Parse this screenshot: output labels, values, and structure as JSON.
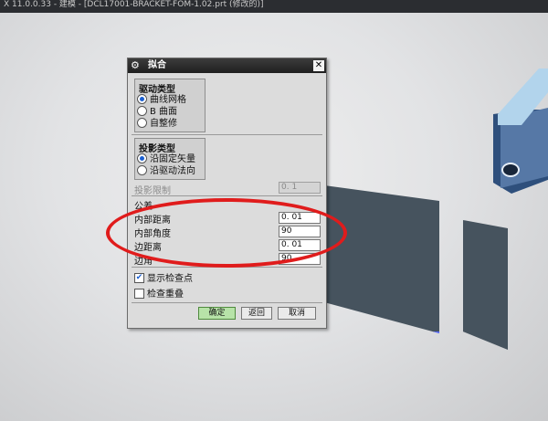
{
  "window": {
    "title": "X 11.0.0.33 - 建模 - [DCL17001-BRACKET-FOM-1.02.prt (修改的)]"
  },
  "dialog": {
    "title": "拟合",
    "close_glyph": "✕",
    "gear_glyph": "⚙",
    "drive_type": {
      "title": "驱动类型",
      "options": [
        "曲线网格",
        "B 曲面",
        "自整修"
      ],
      "selected": 0
    },
    "projection_type": {
      "title": "投影类型",
      "options": [
        "沿固定矢量",
        "沿驱动法向"
      ],
      "selected": 0
    },
    "projection_limit": {
      "label": "投影限制",
      "value": "0. 1"
    },
    "tolerance": {
      "title": "公差",
      "inner_distance": {
        "label": "内部距离",
        "value": "0. 01"
      },
      "inner_angle": {
        "label": "内部角度",
        "value": "90"
      },
      "edge_distance": {
        "label": "边距离",
        "value": "0. 01"
      },
      "edge_angle": {
        "label": "边角",
        "value": "90"
      }
    },
    "show_check_points": {
      "label": "显示检查点",
      "checked": true
    },
    "check_overlap": {
      "label": "检查重叠",
      "checked": false
    },
    "buttons": {
      "ok": "确定",
      "back": "返回",
      "cancel": "取消"
    }
  },
  "colors": {
    "annotation": "#e01c1c",
    "dialog_title_bg": "#2a2a2a",
    "ok_button": "#b7e3a8",
    "model_plate": "#46535e",
    "model_block": "#5678a6"
  },
  "checkmark_glyph": "✔"
}
